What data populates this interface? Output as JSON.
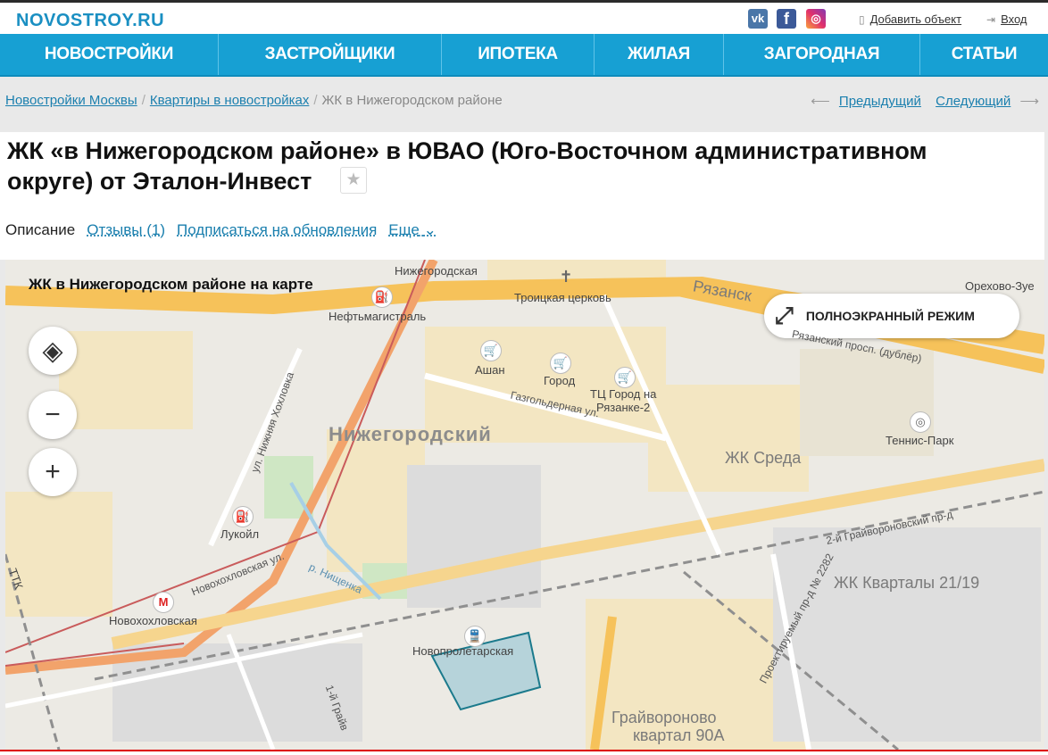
{
  "header": {
    "logo": "NOVOSTROY.RU",
    "social": {
      "vk": "vk",
      "fb": "f",
      "ig": "◎"
    },
    "add_object": "Добавить объект",
    "login": "Вход"
  },
  "nav": {
    "items": [
      {
        "label": "НОВОСТРОЙКИ"
      },
      {
        "label": "ЗАСТРОЙЩИКИ"
      },
      {
        "label": "ИПОТЕКА"
      },
      {
        "label": "ЖИЛАЯ"
      },
      {
        "label": "ЗАГОРОДНАЯ"
      },
      {
        "label": "СТАТЬИ"
      }
    ]
  },
  "breadcrumbs": {
    "items": [
      "Новостройки Москвы",
      "Квартиры в новостройках"
    ],
    "current": "ЖК в Нижегородском районе",
    "sep": "/"
  },
  "pager": {
    "prev": "Предыдущий",
    "next": "Следующий",
    "prev_arrow": "⟵",
    "next_arrow": "⟶"
  },
  "page": {
    "title": "ЖК «в Нижегородском районе» в ЮВАО (Юго-Восточном административном округе) от Эталон-Инвест",
    "favorite_icon": "★"
  },
  "tabs": {
    "description": "Описание",
    "reviews": "Отзывы (1)",
    "subscribe": "Подписаться на обновления",
    "more": "Еще"
  },
  "map": {
    "title": "ЖК в Нижегородском районе на карте",
    "fullscreen": "ПОЛНОЭКРАННЫЙ РЕЖИМ",
    "controls": {
      "layers": "◈",
      "zoom_out": "−",
      "zoom_in": "+"
    },
    "labels": {
      "district": "Нижегородский",
      "nizhegorodskaya": "Нижегородская",
      "troitskaya": "Троицкая церковь",
      "neftmagistral": "Нефтьмагистраль",
      "ashan": "Ашан",
      "gorod": "Город",
      "tc_gorod": "ТЦ Город на",
      "tc_gorod2": "Рязанке-2",
      "gazgolder": "Газгольдерная ул.",
      "ryazansky": "Рязанск",
      "ryazansky_dubler": "Рязанский просп. (дублёр)",
      "orekhovo": "Орехово-Зуе",
      "tennis": "Теннис-Парк",
      "zhk_sreda": "ЖК Среда",
      "zhk_kvartaly": "ЖК Кварталы 21/19",
      "grayvoronovsky": "2-й Грайвороновский пр-д",
      "proektiruemy": "Проектируемый пр-д № 2282",
      "grayvoronovo": "Грайвороново",
      "kvartal": "квартал 90А",
      "lukoil": "Лукойл",
      "novokhokhlovskaya_st": "Новохохловская",
      "novokhokhlovskaya_ul": "Новохохловская ул.",
      "nizhnyaya_khokhlovka": "ул. Нижняя Хохловка",
      "nishchenka": "р. Нищенка",
      "novoproletarskaya": "Новопролетарская",
      "grayvoronovsky1": "1-й Грайв",
      "ttk": "ТТК"
    }
  }
}
